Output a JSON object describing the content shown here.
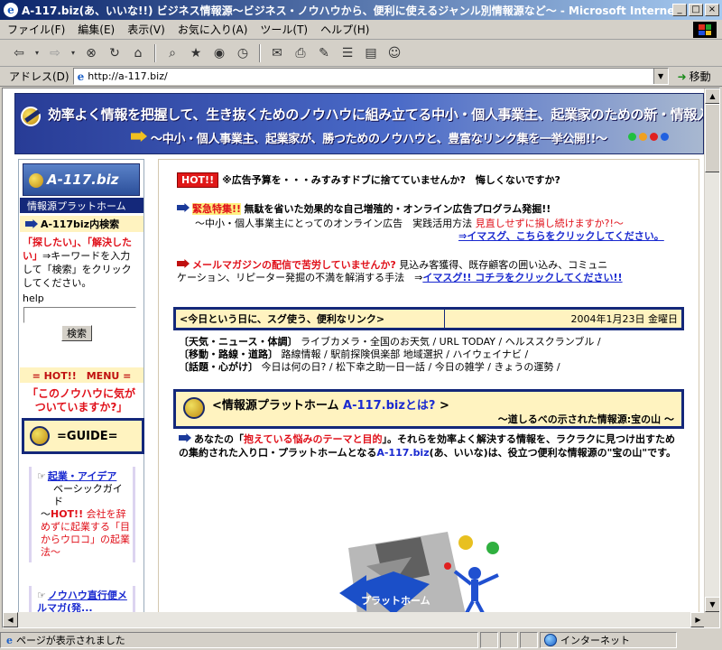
{
  "window": {
    "title": "A-117.biz(あ、いいな!!) ビジネス情報源〜ビジネス・ノウハウから、便利に使えるジャンル別情報源など〜 - Microsoft Internet Explorer",
    "min": "_",
    "max": "□",
    "close": "×"
  },
  "menu": [
    "ファイル(F)",
    "編集(E)",
    "表示(V)",
    "お気に入り(A)",
    "ツール(T)",
    "ヘルプ(H)"
  ],
  "address": {
    "label": "アドレス(D)",
    "url": "http://a-117.biz/",
    "go": "移動"
  },
  "banner": {
    "headline": "効率よく情報を把握して、生き抜くためのノウハウに組み立てる中小・個人事業主、起業家のための新・情報入手ガイド",
    "subline": "〜中小・個人事業主、起業家が、勝つためのノウハウと、豊富なリンク集を一挙公開!!〜",
    "dot_colors": [
      "#20c040",
      "#f0a020",
      "#e02020",
      "#2060e0"
    ]
  },
  "sidebar": {
    "logo": "A-117.biz",
    "platform_head": "情報源プラットホーム",
    "search_head": "A-117biz内検索",
    "search_red": "「探したい」、「解決したい」",
    "search_text": "⇒キーワードを入力して「検索」をクリックしてください。",
    "search_label": "help",
    "search_button": "検索",
    "menu_strip": "= HOT!!　MENU =",
    "notice": "「このノウハウに気がついていますか?」",
    "guide": "=GUIDE=",
    "item1_title": "起業・アイデア",
    "item1_sub": "ベーシックガイド",
    "item1_hot": "HOT!!",
    "item1_desc": "会社を辞めずに起業する「目からウロコ」の起業法〜",
    "item2_title": "ノウハウ直行便メルマガ(発..."
  },
  "main": {
    "hot": "HOT!!",
    "ad_warning": "※広告予算を・・・みすみすドブに捨てていませんか?　悔しくないですか?",
    "special_label": "緊急特集!!",
    "special_title": "無駄を省いた効果的な自己増殖的・オンライン広告プログラム発掘!!",
    "special_sub": "〜中小・個人事業主にとってのオンライン広告　実践活用方法",
    "special_red": "見直しせずに損し続けますか?!〜",
    "special_link": "⇒イマスグ、こちらをクリックしてください。",
    "mail_title": "メールマガジンの配信で苦労していませんか?",
    "mail_desc1": "見込み客獲得、既存顧客の囲い込み、コミュニ",
    "mail_desc2": "ケーション、リピーター発掘の不満を解消する手法　⇒",
    "mail_link": "イマスグ!! コチラをクリックしてください!!",
    "today_label": "<今日という日に、スグ使う、便利なリンク>",
    "today_date": "2004年1月23日 金曜日",
    "cats": [
      {
        "cat": "〔天気・ニュース・体調〕",
        "links": "ライブカメラ・全国のお天気 / URL TODAY / ヘルススクランブル /"
      },
      {
        "cat": "〔移動・路線・道路〕",
        "links": "路線情報 / 駅前探険倶楽部 地域選択 / ハイウェイナビ /"
      },
      {
        "cat": "〔話題・心がけ〕",
        "links": "今日は何の日? / 松下幸之助一日一話 / 今日の雑学 / きょうの運勢 /"
      }
    ],
    "info_title_a": "<情報源プラットホーム ",
    "info_title_b": "A-117.bizとは?",
    "info_title_c": " >",
    "info_sub": "〜道しるべの示された情報源:宝の山 〜",
    "para_a": "あなたの「",
    "para_b": "抱えている悩みのテーマと目的",
    "para_c": "」。それらを効率よく解決する情報を、ラクラクに見つけ出すための集約された入り口・プラットホームとなる",
    "para_d": "A-117.biz",
    "para_e": "(あ、いいな)は、役立つ便利な情報源の\"宝の山\"です。",
    "platform_label": "プラットホーム"
  },
  "status": {
    "text": "ページが表示されました",
    "zone": "インターネット"
  }
}
